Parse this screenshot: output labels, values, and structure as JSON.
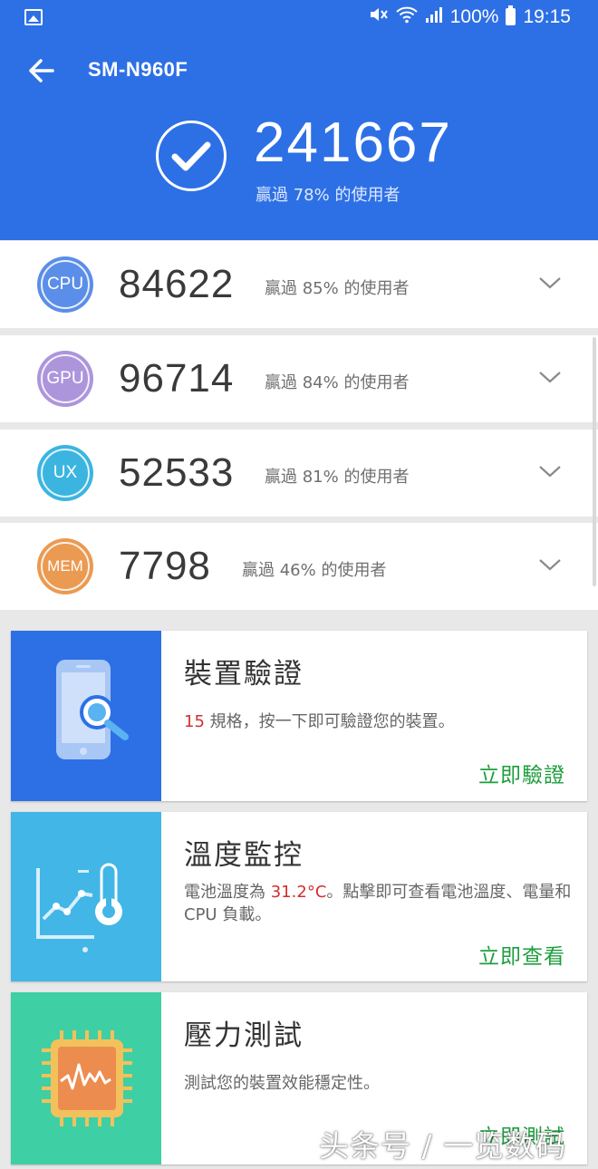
{
  "status_bar": {
    "battery": "100%",
    "time": "19:15"
  },
  "header": {
    "title": "SM-N960F",
    "total_score": "241667",
    "total_subtitle": "贏過 78% 的使用者"
  },
  "scores": [
    {
      "badge": "CPU",
      "score": "84622",
      "subtitle": "贏過 85% 的使用者",
      "color": "#5b8ee8"
    },
    {
      "badge": "GPU",
      "score": "96714",
      "subtitle": "贏過 84% 的使用者",
      "color": "#ad95dc"
    },
    {
      "badge": "UX",
      "score": "52533",
      "subtitle": "贏過 81% 的使用者",
      "color": "#3bb5e0"
    },
    {
      "badge": "MEM",
      "score": "7798",
      "subtitle": "贏過 46% 的使用者",
      "color": "#eb9a52"
    }
  ],
  "cards": {
    "verify": {
      "title": "裝置驗證",
      "desc_number": "15",
      "desc_text": " 規格，按一下即可驗證您的裝置。",
      "action": "立即驗證",
      "color": "#2d70e6"
    },
    "temperature": {
      "title": "溫度監控",
      "desc_pre": "電池溫度為 ",
      "desc_temp": "31.2°C",
      "desc_post": "。點擊即可查看電池溫度、電量和 CPU 負載。",
      "action": "立即查看",
      "color": "#42b6e6"
    },
    "stress": {
      "title": "壓力測試",
      "desc": "測試您的裝置效能穩定性。",
      "action": "立即測試",
      "color": "#3fcfa4"
    }
  },
  "watermark": "头条号 / 一览数码"
}
